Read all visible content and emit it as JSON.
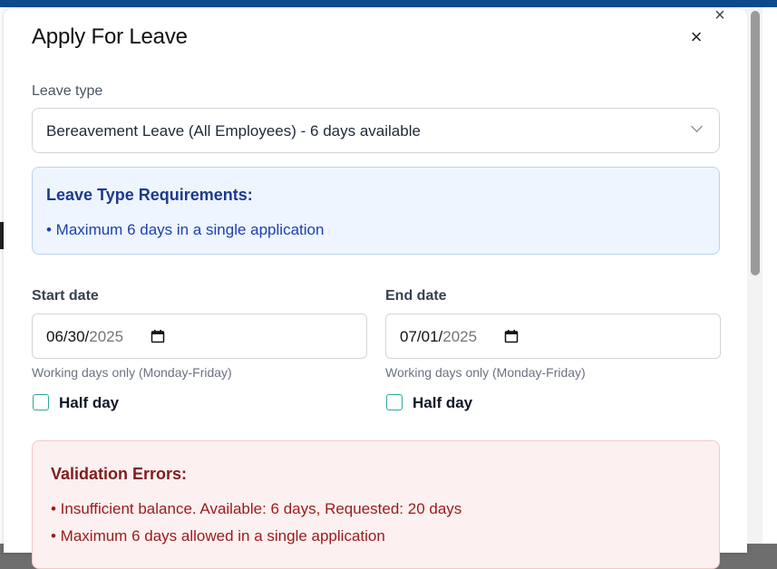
{
  "modal": {
    "title": "Apply For Leave",
    "close_glyph": "×",
    "outer_close_glyph": "×"
  },
  "leave_type": {
    "label": "Leave type",
    "selected": "Bereavement Leave (All Employees) - 6 days available"
  },
  "requirements": {
    "title": "Leave Type Requirements:",
    "items": [
      "• Maximum 6 days in a single application"
    ]
  },
  "start_date": {
    "label": "Start date",
    "value_md": "06/30/",
    "value_year": "2025",
    "hint": "Working days only (Monday-Friday)",
    "half_day_label": "Half day"
  },
  "end_date": {
    "label": "End date",
    "value_md": "07/01/",
    "value_year": "2025",
    "hint": "Working days only (Monday-Friday)",
    "half_day_label": "Half day"
  },
  "validation": {
    "title": "Validation Errors:",
    "items": [
      "• Insufficient balance. Available: 6 days, Requested: 20 days",
      "• Maximum 6 days allowed in a single application"
    ]
  },
  "colors": {
    "topbar": "#0b4a8b",
    "info_bg": "#eef5ff",
    "error_bg": "#fdf0f0",
    "checkbox_border": "#2fa89a"
  },
  "icons": {
    "calendar": "calendar-icon",
    "chevron": "chevron-down-icon",
    "close": "close-icon"
  }
}
